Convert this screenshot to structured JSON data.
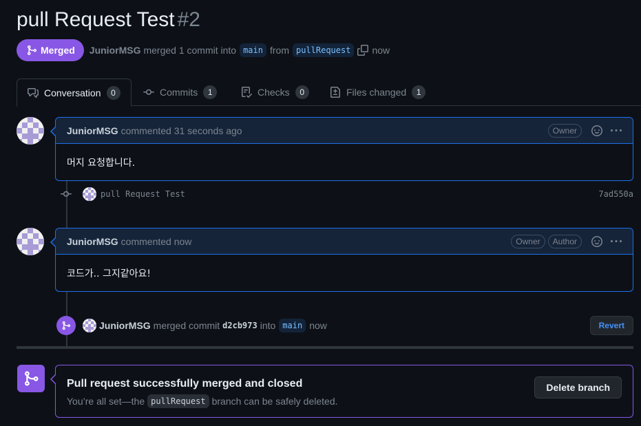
{
  "pr": {
    "title": "pull Request Test",
    "number": "#2",
    "state_label": "Merged",
    "author": "JuniorMSG",
    "action_text": "merged 1 commit into",
    "base_branch": "main",
    "from_text": "from",
    "head_branch": "pullRequest",
    "time": "now"
  },
  "tabs": [
    {
      "label": "Conversation",
      "count": "0",
      "icon": "comment-discussion-icon"
    },
    {
      "label": "Commits",
      "count": "1",
      "icon": "git-commit-icon"
    },
    {
      "label": "Checks",
      "count": "0",
      "icon": "checklist-icon"
    },
    {
      "label": "Files changed",
      "count": "1",
      "icon": "file-diff-icon"
    }
  ],
  "comments": [
    {
      "author": "JuniorMSG",
      "when": "commented 31 seconds ago",
      "roles": [
        "Owner"
      ],
      "body": "머지 요청합니다."
    },
    {
      "author": "JuniorMSG",
      "when": "commented now",
      "roles": [
        "Owner",
        "Author"
      ],
      "body": "코드가.. 그지같아요!"
    }
  ],
  "commit": {
    "message": "pull Request Test",
    "sha": "7ad550a"
  },
  "merge_event": {
    "author": "JuniorMSG",
    "text1": "merged commit",
    "sha": "d2cb973",
    "text2": "into",
    "branch": "main",
    "time": "now",
    "revert_label": "Revert"
  },
  "merged_status": {
    "title": "Pull request successfully merged and closed",
    "sub_before": "You’re all set—the",
    "branch": "pullRequest",
    "sub_after": "branch can be safely deleted.",
    "delete_label": "Delete branch"
  },
  "colors": {
    "background": "#0d1117",
    "merged_purple": "#8957e5",
    "comment_border": "#1f6feb",
    "link_blue": "#4493f8"
  }
}
